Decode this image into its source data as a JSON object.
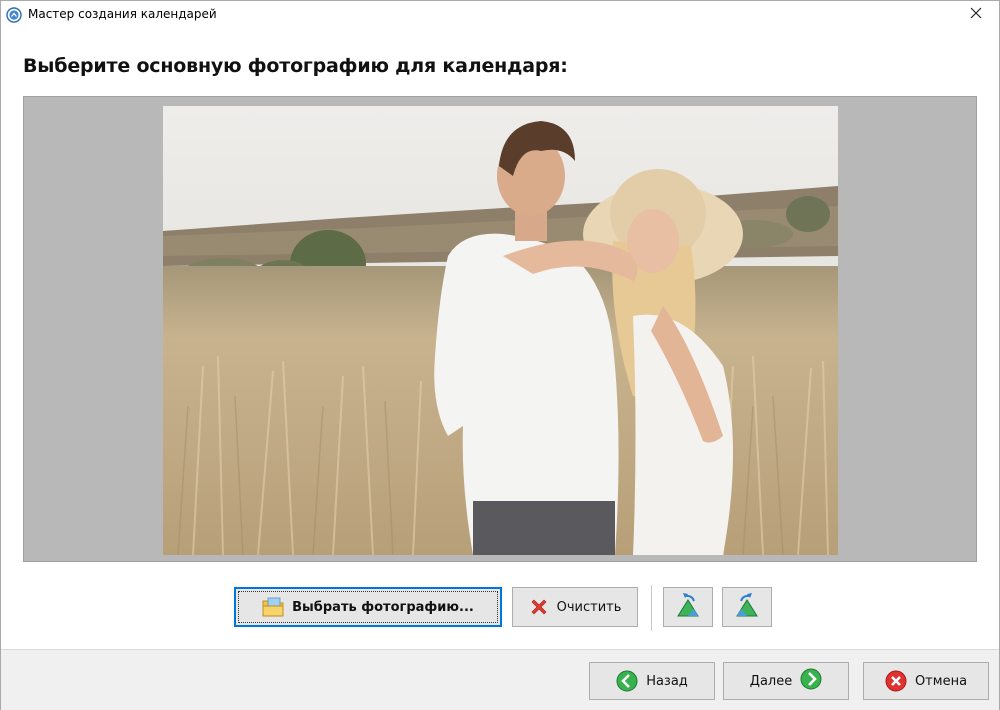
{
  "window": {
    "title": "Мастер создания календарей",
    "close_icon": "close-icon"
  },
  "main": {
    "heading": "Выберите основную фотографию для календаря:",
    "photo": {
      "description_icon": "couple-in-wheat-field-photo",
      "sky_color": "#e8e6e2",
      "field_color": "#c9b18a"
    }
  },
  "toolbar": {
    "choose_label": "Выбрать фотографию...",
    "clear_label": "Очистить",
    "rotate_left_icon": "rotate-left-icon",
    "rotate_right_icon": "rotate-right-icon"
  },
  "footer": {
    "back_label": "Назад",
    "next_label": "Далее",
    "cancel_label": "Отмена"
  },
  "colors": {
    "accent": "#0078d7",
    "preview_bg": "#b8b8b8",
    "button_bg": "#e6e6e6",
    "footer_bg": "#f0f0f0"
  }
}
